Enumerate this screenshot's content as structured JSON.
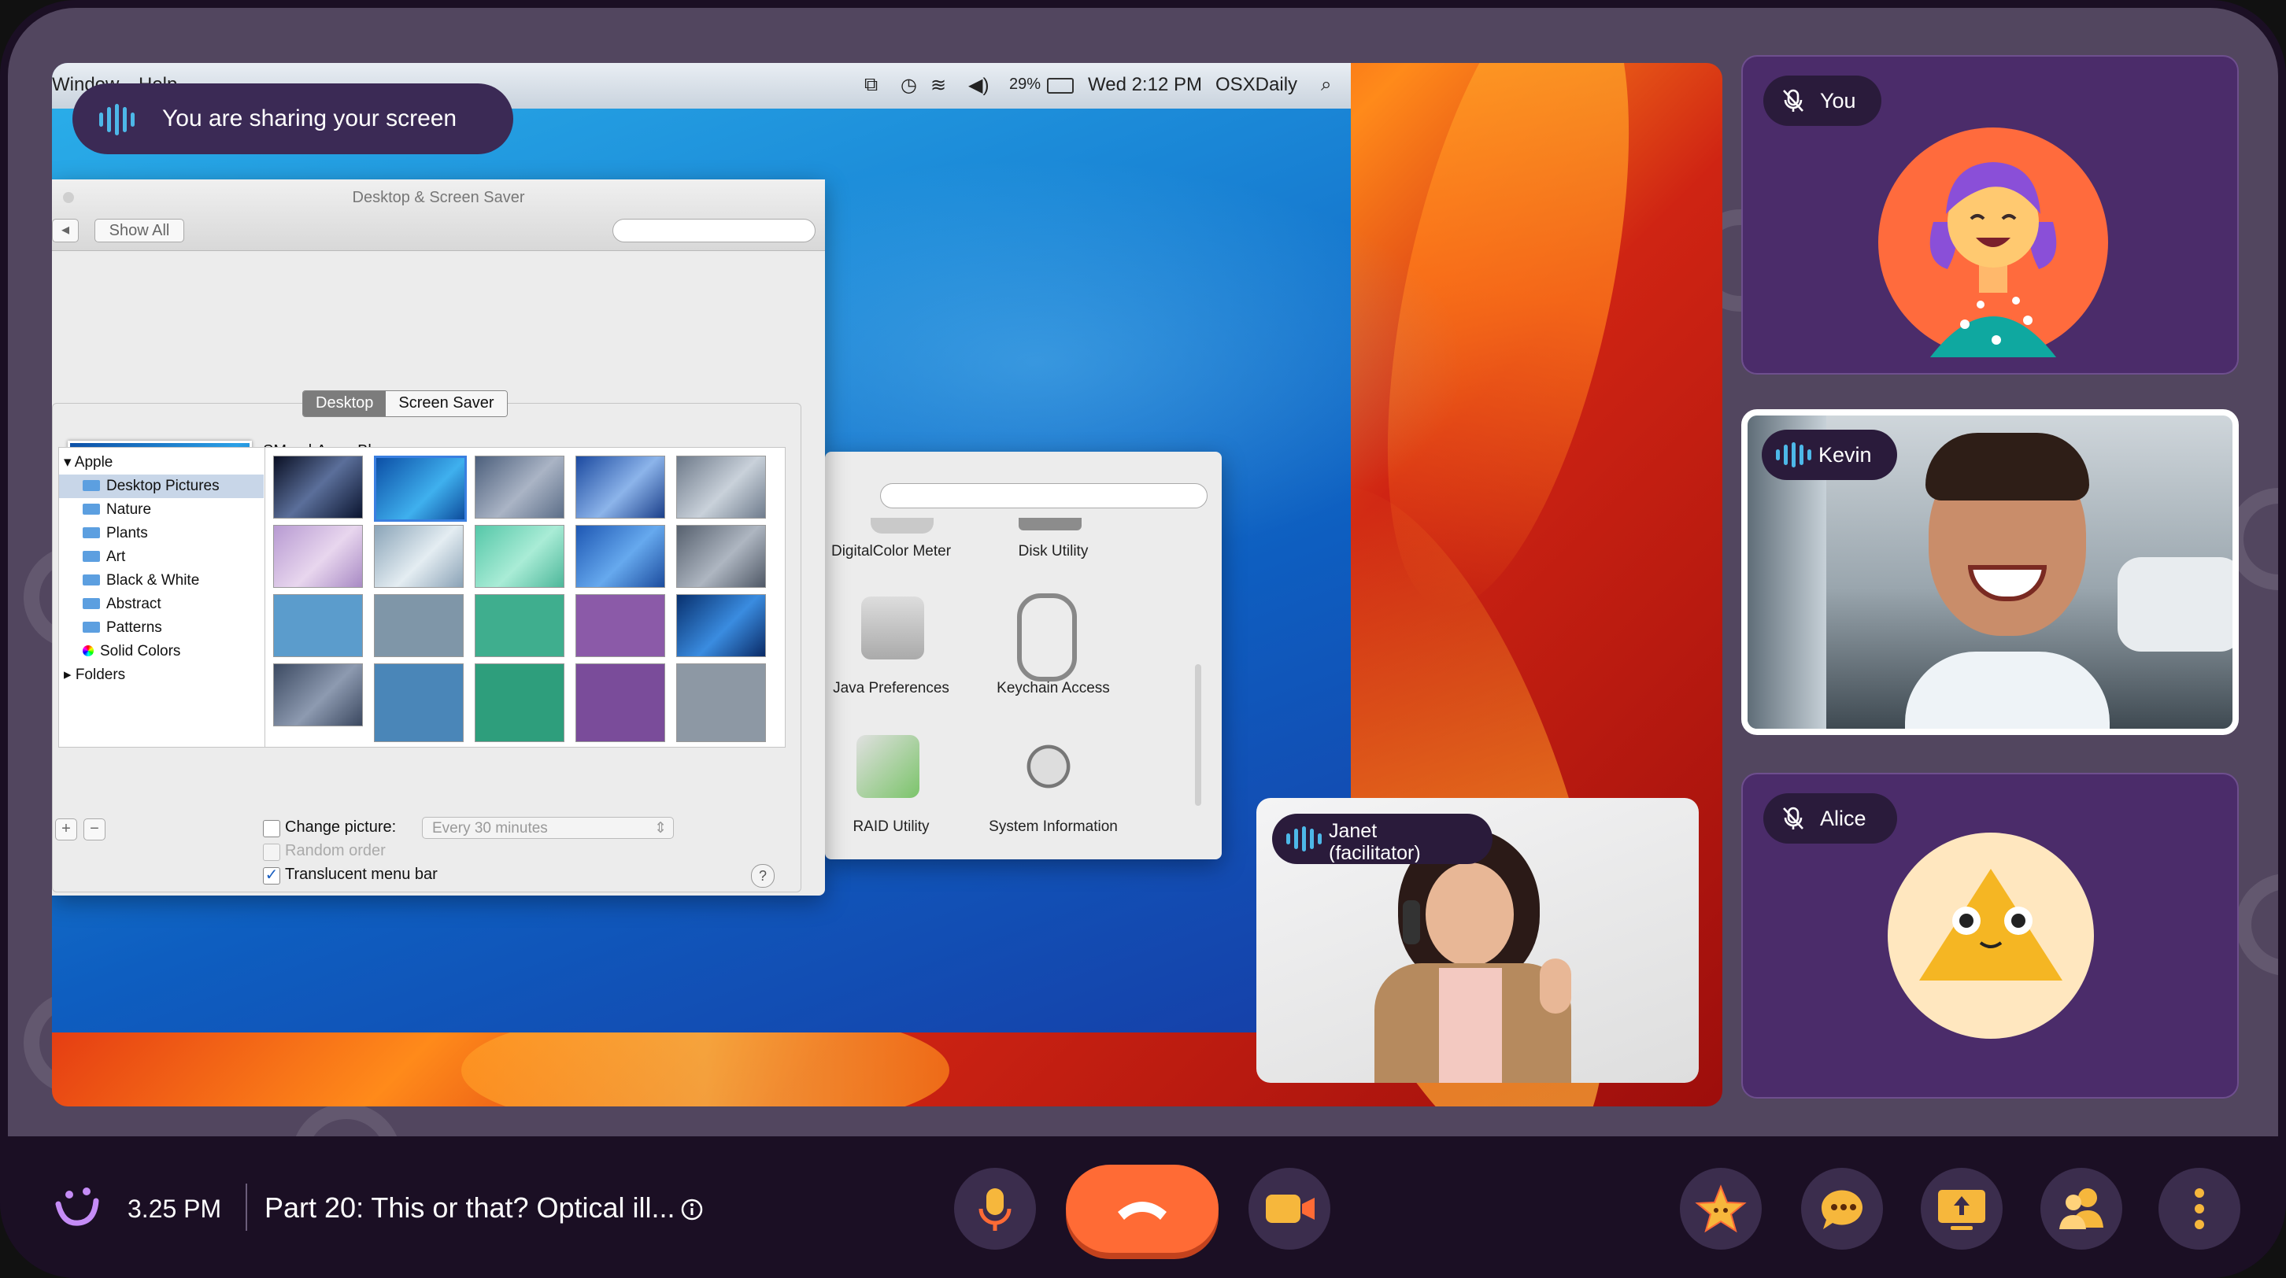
{
  "share_banner": {
    "text": "You are sharing your screen"
  },
  "shared_screen": {
    "menubar": {
      "left_items": [
        "Window",
        "Help"
      ],
      "battery": "29%",
      "clock": "Wed 2:12 PM",
      "user": "OSXDaily"
    },
    "prefs_window": {
      "title": "Desktop & Screen Saver",
      "show_all": "Show All",
      "tabs": [
        "Desktop",
        "Screen Saver"
      ],
      "current_picture": "SM.gul.Aqua Blue",
      "sidebar": {
        "group": "Apple",
        "items": [
          "Desktop Pictures",
          "Nature",
          "Plants",
          "Art",
          "Black & White",
          "Abstract",
          "Patterns",
          "Solid Colors"
        ],
        "footer_group": "Folders"
      },
      "options": {
        "change_picture": "Change picture:",
        "interval": "Every 30 minutes",
        "random_order": "Random order",
        "translucent_menu_bar": "Translucent menu bar"
      },
      "add_label": "+",
      "remove_label": "−",
      "help_label": "?"
    },
    "utilities_window": {
      "items": [
        "DigitalColor Meter",
        "Disk Utility",
        "Java Preferences",
        "Keychain Access",
        "RAID Utility",
        "System Information"
      ]
    }
  },
  "participants": [
    {
      "name": "You",
      "muted": true
    },
    {
      "name": "Kevin",
      "muted": false,
      "speaking": true
    },
    {
      "name": "Alice",
      "muted": true
    }
  ],
  "presenter": {
    "name": "Janet",
    "role": "(facilitator)"
  },
  "bottom_bar": {
    "time": "3.25 PM",
    "session_title": "Part 20: This or that? Optical ill...",
    "info_icon": "info-icon",
    "controls": [
      "microphone-icon",
      "end-call-icon",
      "camera-icon"
    ],
    "right_controls": [
      "star-icon",
      "chat-icon",
      "present-icon",
      "people-icon",
      "more-icon"
    ]
  },
  "colors": {
    "accent_orange": "#ff6b35",
    "tile_purple": "#4b2c6a",
    "speaking_border": "#ffffff",
    "waveform_blue": "#4db8e8"
  }
}
